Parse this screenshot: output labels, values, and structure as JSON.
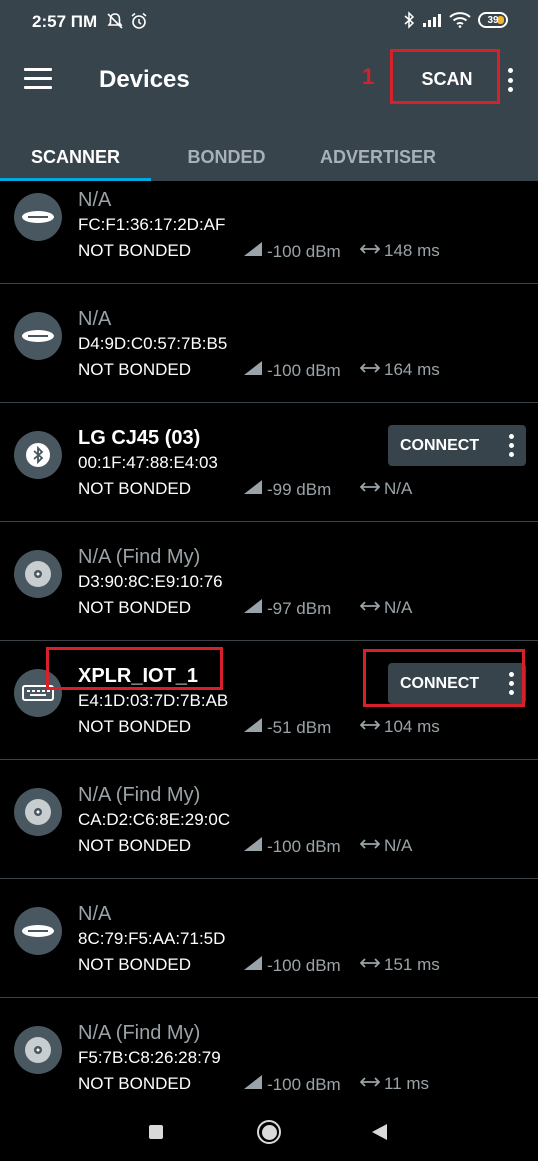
{
  "status_bar": {
    "time": "2:57 ПМ",
    "battery": "39",
    "icons": [
      "mute-icon",
      "alarm-icon",
      "bluetooth-icon",
      "signal-icon",
      "wifi-icon",
      "battery-icon"
    ]
  },
  "app_bar": {
    "title": "Devices",
    "annotation_number": "1",
    "scan_label": "SCAN",
    "tabs": [
      {
        "label": "SCANNER",
        "active": true
      },
      {
        "label": "BONDED",
        "active": false
      },
      {
        "label": "ADVERTISER",
        "active": false
      }
    ]
  },
  "devices": [
    {
      "name": "N/A",
      "mac": "FC:F1:36:17:2D:AF",
      "bond": "NOT BONDED",
      "rssi": "-100 dBm",
      "interval": "148 ms",
      "icon": "samsung-icon",
      "connectable": false
    },
    {
      "name": "N/A",
      "mac": "D4:9D:C0:57:7B:B5",
      "bond": "NOT BONDED",
      "rssi": "-100 dBm",
      "interval": "164 ms",
      "icon": "samsung-icon",
      "connectable": false
    },
    {
      "name": "LG CJ45  (03)",
      "mac": "00:1F:47:88:E4:03",
      "bond": "NOT BONDED",
      "rssi": "-99 dBm",
      "interval": "N/A",
      "icon": "bluetooth-icon",
      "connectable": true,
      "connect_label": "CONNECT"
    },
    {
      "name": "N/A  (Find My)",
      "mac": "D3:90:8C:E9:10:76",
      "bond": "NOT BONDED",
      "rssi": "-97 dBm",
      "interval": "N/A",
      "icon": "disc-icon",
      "connectable": false
    },
    {
      "name": "XPLR_IOT_1",
      "mac": "E4:1D:03:7D:7B:AB",
      "bond": "NOT BONDED",
      "rssi": "-51 dBm",
      "interval": "104 ms",
      "icon": "keyboard-icon",
      "connectable": true,
      "connect_label": "CONNECT"
    },
    {
      "name": "N/A  (Find My)",
      "mac": "CA:D2:C6:8E:29:0C",
      "bond": "NOT BONDED",
      "rssi": "-100 dBm",
      "interval": "N/A",
      "icon": "disc-icon",
      "connectable": false
    },
    {
      "name": "N/A",
      "mac": "8C:79:F5:AA:71:5D",
      "bond": "NOT BONDED",
      "rssi": "-100 dBm",
      "interval": "151 ms",
      "icon": "samsung-icon",
      "connectable": false
    },
    {
      "name": "N/A  (Find My)",
      "mac": "F5:7B:C8:26:28:79",
      "bond": "NOT BONDED",
      "rssi": "-100 dBm",
      "interval": "11 ms",
      "icon": "disc-icon",
      "connectable": false
    }
  ],
  "colors": {
    "app_bar": "#37444c",
    "accent": "#00a9e0",
    "annotation_red": "#d6202a",
    "battery_fill": "#f2b233"
  }
}
